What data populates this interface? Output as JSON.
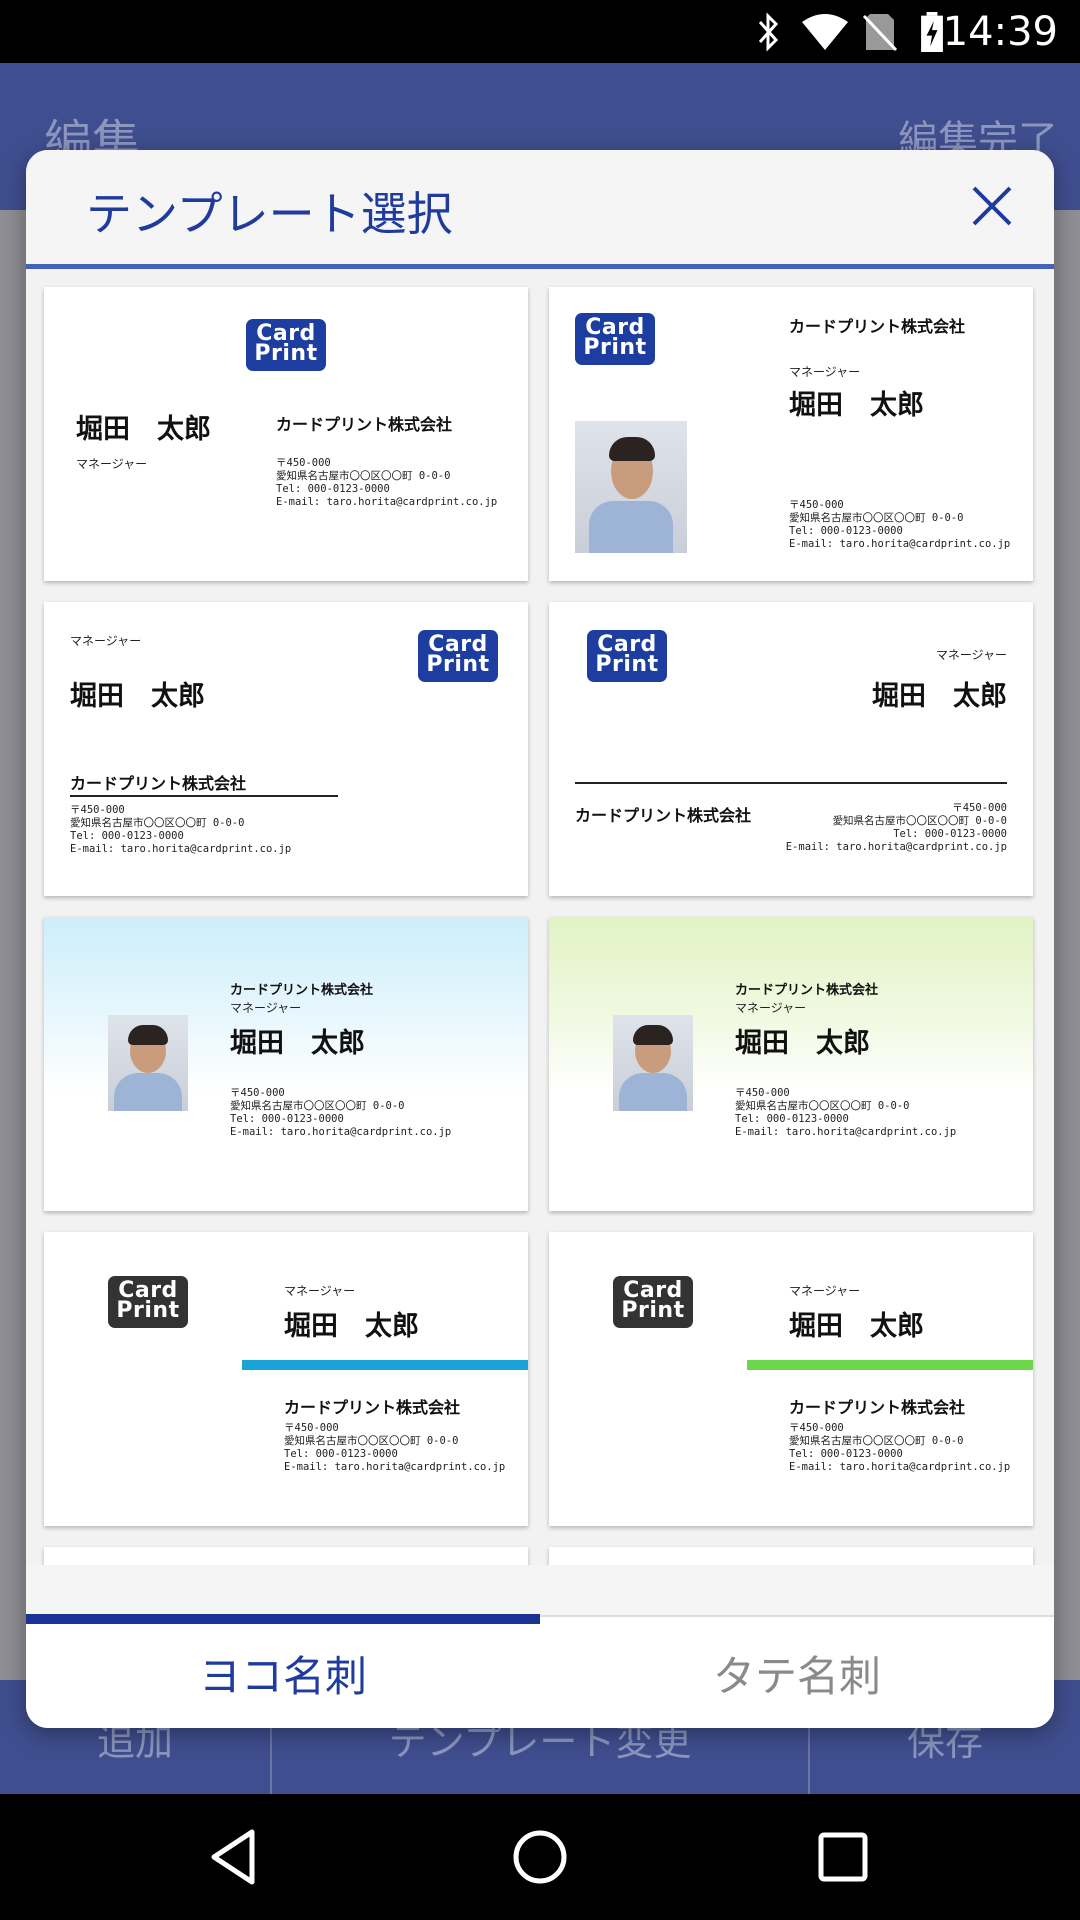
{
  "status_bar": {
    "time": "14:39",
    "icons": [
      "bluetooth-icon",
      "wifi-icon",
      "no-sim-icon",
      "battery-charging-icon"
    ]
  },
  "app": {
    "title": "編集",
    "done_label": "編集完了"
  },
  "bottom_bar": {
    "add_label": "追加",
    "template_change_label": "テンプレート変更",
    "save_label": "保存"
  },
  "dialog": {
    "title": "テンプレート選択",
    "tabs": [
      {
        "label": "ヨコ名刺",
        "active": true
      },
      {
        "label": "タテ名刺",
        "active": false
      }
    ]
  },
  "card": {
    "logo_line1": "Card",
    "logo_line2": "Print",
    "name": "堀田　太郎",
    "role": "マネージャー",
    "company": "カードプリント株式会社",
    "postal": "〒450-000",
    "address": "愛知県名古屋市〇〇区〇〇町 0-0-0",
    "tel": "Tel: 000-0123-0000",
    "email": "E-mail: taro.horita@cardprint.co.jp"
  },
  "colors": {
    "accent": "#3f4e8f",
    "dialog_title": "#1f3b9c",
    "tab_indicator": "#1a3296",
    "logo_blue": "#1d3ea0",
    "bar_blue": "#1aa3d6",
    "bar_green": "#6ed64a"
  }
}
